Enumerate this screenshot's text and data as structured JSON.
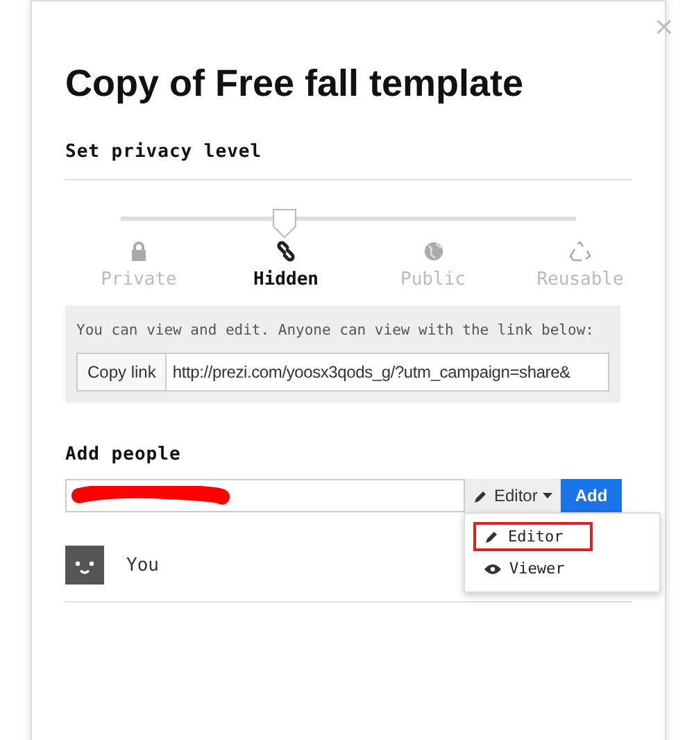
{
  "dialog": {
    "title": "Copy of Free fall template",
    "close": "×"
  },
  "privacy": {
    "heading": "Set privacy level",
    "slider": {
      "level": 0.34
    },
    "options": [
      {
        "kind": "lock",
        "label": "Private",
        "selected": false
      },
      {
        "kind": "link",
        "label": "Hidden",
        "selected": true
      },
      {
        "kind": "globe",
        "label": "Public",
        "selected": false
      },
      {
        "kind": "recycle",
        "label": "Reusable",
        "selected": false
      }
    ],
    "note": "You can view and edit. Anyone can view with the link below:",
    "copy_button": "Copy link",
    "link": "http://prezi.com/yoosx3qods_g/?utm_campaign=share&"
  },
  "add_people": {
    "heading": "Add people",
    "role_button": "Editor",
    "add_button": "Add",
    "menu": [
      {
        "kind": "pencil",
        "label": "Editor",
        "highlighted": true
      },
      {
        "kind": "eye",
        "label": "Viewer",
        "highlighted": false
      }
    ],
    "people": [
      {
        "name": "You"
      }
    ]
  }
}
